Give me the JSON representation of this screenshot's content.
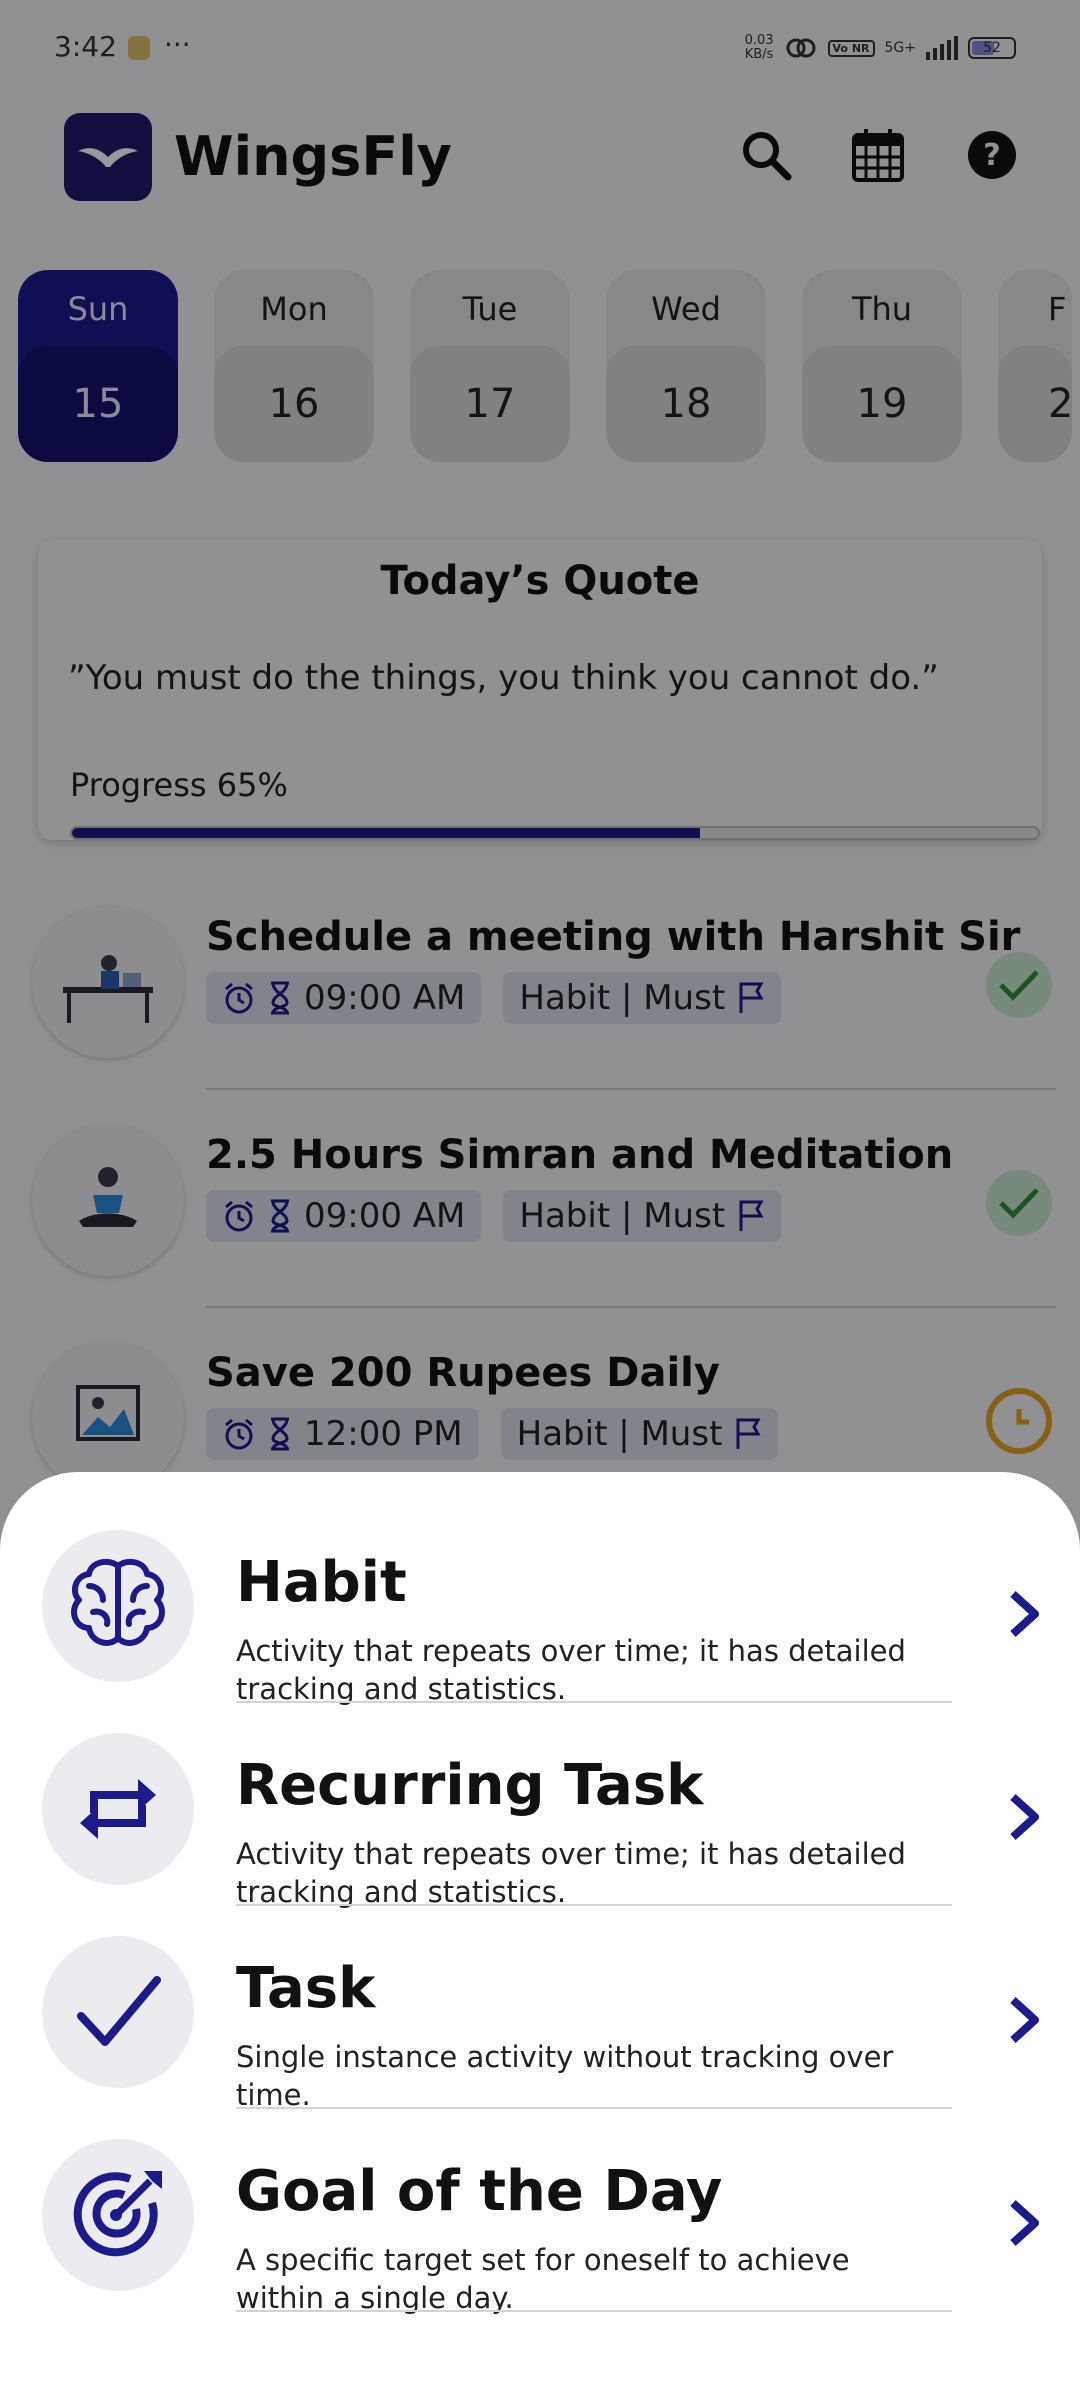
{
  "status_bar": {
    "time": "3:42",
    "more": "···",
    "speed_top": "0.03",
    "speed_unit": "KB/s",
    "volte": "Vo NR",
    "network": "5G+",
    "battery": "52"
  },
  "app": {
    "title": "WingsFly"
  },
  "days": [
    {
      "name": "Sun",
      "date": "15",
      "selected": true
    },
    {
      "name": "Mon",
      "date": "16"
    },
    {
      "name": "Tue",
      "date": "17"
    },
    {
      "name": "Wed",
      "date": "18"
    },
    {
      "name": "Thu",
      "date": "19"
    },
    {
      "name": "F",
      "date": "2"
    }
  ],
  "quote": {
    "title": "Today’s Quote",
    "text": "”You must do the things, you think you cannot do.”",
    "progress_label": "Progress 65%",
    "progress": 0.65
  },
  "tasks": [
    {
      "title": "Schedule a meeting with Harshit Sir",
      "time": "09:00 AM",
      "category": "Habit | Must",
      "status": "done"
    },
    {
      "title": "2.5 Hours Simran and Meditation",
      "time": "09:00 AM",
      "category": "Habit | Must",
      "status": "done"
    },
    {
      "title": "Save 200 Rupees Daily",
      "time": "12:00 PM",
      "category": "Habit | Must",
      "status": "pending"
    }
  ],
  "sheet": {
    "options": [
      {
        "title": "Habit",
        "description": "Activity that repeats over time; it has detailed tracking and statistics.",
        "icon": "brain-icon"
      },
      {
        "title": "Recurring Task",
        "description": "Activity that repeats over time; it has detailed tracking and statistics.",
        "icon": "repeat-icon"
      },
      {
        "title": "Task",
        "description": "Single instance activity without tracking over time.",
        "icon": "checkmark-icon"
      },
      {
        "title": "Goal of the Day",
        "description": "A specific target set for oneself to achieve within a single day.",
        "icon": "target-icon"
      }
    ]
  },
  "colors": {
    "primary": "#1c1a8c",
    "done": "#c7e6cd",
    "pending": "#e0a020"
  }
}
